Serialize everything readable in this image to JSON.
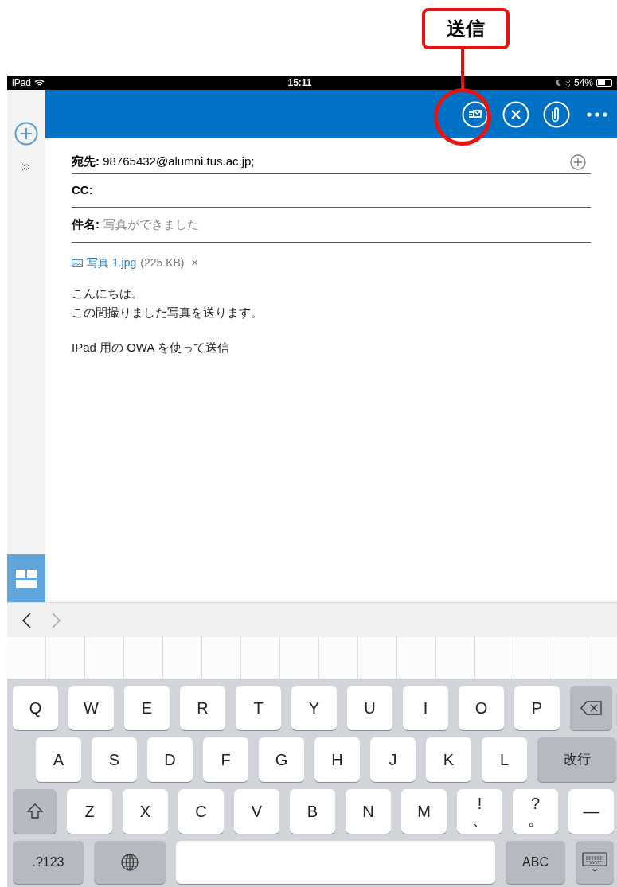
{
  "annotation": {
    "label": "送信"
  },
  "status_bar": {
    "device": "iPad",
    "time": "15:11",
    "battery": "54%"
  },
  "toolbar": {
    "buttons": [
      {
        "kind": "send"
      },
      {
        "kind": "discard"
      },
      {
        "kind": "attach"
      },
      {
        "kind": "more"
      }
    ]
  },
  "compose": {
    "to_label": "宛先:",
    "to": "98765432@alumni.tus.ac.jp;",
    "cc_label": "CC:",
    "subject_label": "件名:",
    "subject": "写真ができました",
    "attachment": {
      "name": "写真 1.jpg",
      "size": "(225 KB)",
      "remove": "×"
    },
    "body": [
      {
        "lines": [
          "こんにちは。",
          "この間撮りました写真を送ります。"
        ]
      },
      {
        "lines": [
          "IPad 用の OWA を使って送信"
        ]
      }
    ]
  },
  "keyboard": {
    "rows": [
      {
        "keys": [
          {
            "kind": "letter",
            "label": "Q"
          },
          {
            "kind": "letter",
            "label": "W"
          },
          {
            "kind": "letter",
            "label": "E"
          },
          {
            "kind": "letter",
            "label": "R"
          },
          {
            "kind": "letter",
            "label": "T"
          },
          {
            "kind": "letter",
            "label": "Y"
          },
          {
            "kind": "letter",
            "label": "U"
          },
          {
            "kind": "letter",
            "label": "I"
          },
          {
            "kind": "letter",
            "label": "O"
          },
          {
            "kind": "letter",
            "label": "P"
          },
          {
            "kind": "backspace"
          }
        ]
      },
      {
        "keys": [
          {
            "kind": "letter",
            "label": "A"
          },
          {
            "kind": "letter",
            "label": "S"
          },
          {
            "kind": "letter",
            "label": "D"
          },
          {
            "kind": "letter",
            "label": "F"
          },
          {
            "kind": "letter",
            "label": "G"
          },
          {
            "kind": "letter",
            "label": "H"
          },
          {
            "kind": "letter",
            "label": "J"
          },
          {
            "kind": "letter",
            "label": "K"
          },
          {
            "kind": "letter",
            "label": "L"
          },
          {
            "kind": "return",
            "label": "改行"
          }
        ]
      },
      {
        "keys": [
          {
            "kind": "shift"
          },
          {
            "kind": "letter",
            "label": "Z"
          },
          {
            "kind": "letter",
            "label": "X"
          },
          {
            "kind": "letter",
            "label": "C"
          },
          {
            "kind": "letter",
            "label": "V"
          },
          {
            "kind": "letter",
            "label": "B"
          },
          {
            "kind": "letter",
            "label": "N"
          },
          {
            "kind": "letter",
            "label": "M"
          },
          {
            "kind": "dual",
            "top": "!",
            "bottom": "、"
          },
          {
            "kind": "dual",
            "top": "?",
            "bottom": "。"
          },
          {
            "kind": "letter",
            "label": "—"
          }
        ]
      },
      {
        "keys": [
          {
            "kind": "mode",
            "label": ".?123"
          },
          {
            "kind": "globe"
          },
          {
            "kind": "space"
          },
          {
            "kind": "mode",
            "label": "ABC"
          },
          {
            "kind": "hide"
          }
        ]
      }
    ]
  }
}
